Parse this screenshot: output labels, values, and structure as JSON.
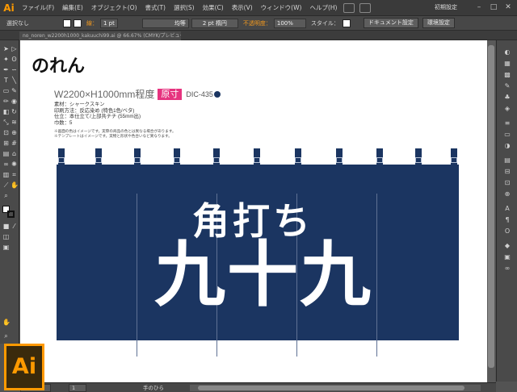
{
  "app": {
    "logo": "Ai",
    "menu": [
      "ファイル(F)",
      "編集(E)",
      "オブジェクト(O)",
      "書式(T)",
      "選択(S)",
      "効果(C)",
      "表示(V)",
      "ウィンドウ(W)",
      "ヘルプ(H)"
    ],
    "workspace": "初期設定"
  },
  "controlbar": {
    "selection": "選択なし",
    "stroke_label": "線：",
    "stroke_width": "1 pt",
    "stroke_profile": "均等",
    "brush": "2 pt 楕円",
    "opacity_label": "不透明度：",
    "opacity": "100%",
    "style_label": "スタイル：",
    "doc_settings": "ドキュメント設定",
    "prefs": "環境設定"
  },
  "document": {
    "tab_title": "no_noren_w2200h1000_kakuuchi99.ai @ 66.67% (CMYK/プレビュー)"
  },
  "artboard": {
    "title": "のれん",
    "size": "W2200×H1000mm程度",
    "badge": "原寸",
    "dic": "DIC-435",
    "details": [
      "素材：シャークスキン",
      "印刷方法：反応染め (特色1色/ベタ)",
      "仕立：本仕立て/上部共チチ (55mm出)",
      "巾数：5"
    ],
    "notes": [
      "※画面の色はイメージです。実際の商品の色とは異なる場合があります。",
      "※テンプレートはイメージです。実物と形状や色合いなど異なります。"
    ],
    "noren_small": "角打ち",
    "noren_big": "九十九"
  },
  "status": {
    "zoom": "66.67%",
    "page": "1",
    "tool": "手のひら"
  },
  "colors": {
    "noren": "#1b3561",
    "badge": "#e6337f",
    "accent": "#ff9a00"
  }
}
